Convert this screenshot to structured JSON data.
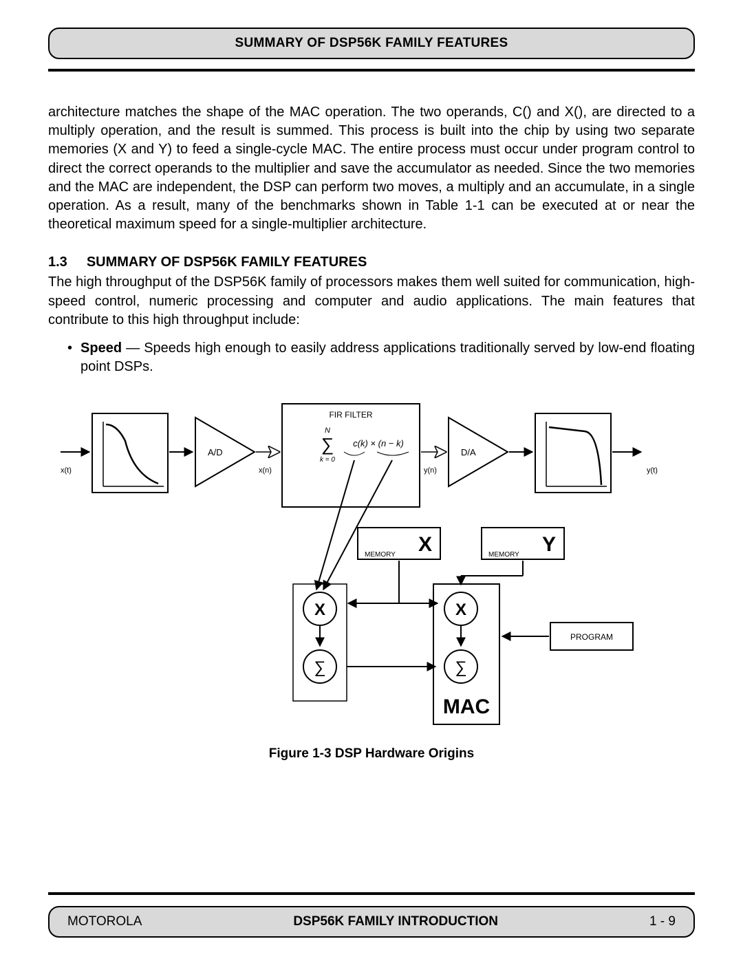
{
  "header": {
    "title": "SUMMARY OF DSP56K FAMILY FEATURES"
  },
  "body": {
    "para1": "architecture matches the shape of the MAC operation. The two operands, C() and X(), are directed to a multiply operation, and the result is summed. This process is built into the chip by using two separate memories (X and Y) to feed a single-cycle MAC. The entire process must occur under program control to direct the correct operands to the multiplier and save the accumulator as needed. Since the two memories and the MAC are independent, the DSP can perform two moves, a multiply and an accumulate, in a single operation. As a result, many of the benchmarks shown in Table 1-1 can be executed at or near the theoretical maximum speed for a single-multiplier architecture.",
    "section_num": "1.3",
    "section_title": "SUMMARY OF DSP56K FAMILY FEATURES",
    "para2": "The high throughput of the DSP56K family of processors makes them well suited for communication, high-speed control, numeric processing and computer and audio applications. The main features that contribute to this high throughput include:",
    "bullet_bold": "Speed",
    "bullet_rest": " — Speeds high enough to easily address applications traditionally served by low-end floating point DSPs."
  },
  "diagram": {
    "xt_left": "x(t)",
    "xn": "x(n)",
    "yn": "y(n)",
    "xt_right": "y(t)",
    "ad": "A/D",
    "da": "D/A",
    "fir": "FIR FILTER",
    "formula_top": "N",
    "formula_sum": "∑",
    "formula_body": "c(k) × (n − k)",
    "formula_base": "k = 0",
    "x_mem": "X",
    "y_mem": "Y",
    "memory": "MEMORY",
    "program": "PROGRAM",
    "circ_x": "X",
    "circ_sum": "∑",
    "mac": "MAC"
  },
  "figure_caption": "Figure 1-3 DSP Hardware Origins",
  "footer": {
    "left": "MOTOROLA",
    "center": "DSP56K FAMILY INTRODUCTION",
    "right": "1 - 9"
  }
}
